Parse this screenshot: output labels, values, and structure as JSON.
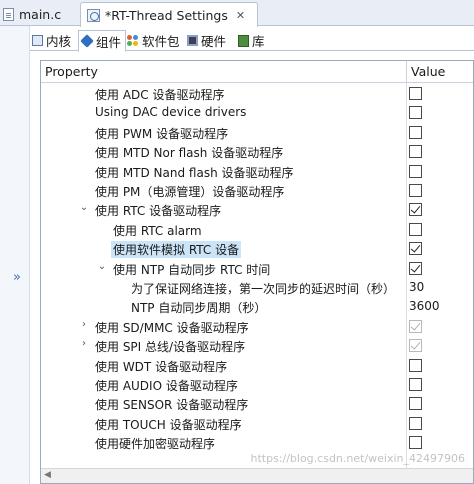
{
  "editor_tabs": [
    {
      "label": "main.c"
    },
    {
      "label": "*RT-Thread Settings",
      "close": "✕"
    }
  ],
  "inner_tabs": [
    {
      "label": "内核"
    },
    {
      "label": "组件"
    },
    {
      "label": "软件包"
    },
    {
      "label": "硬件"
    },
    {
      "label": "库"
    }
  ],
  "side_toggle": "»",
  "table": {
    "header_property": "Property",
    "header_value": "Value",
    "rows": [
      {
        "label": "使用 ADC 设备驱动程序",
        "checked": false
      },
      {
        "label": "Using DAC device drivers",
        "checked": false
      },
      {
        "label": "使用 PWM 设备驱动程序",
        "checked": false
      },
      {
        "label": "使用 MTD Nor flash 设备驱动程序",
        "checked": false
      },
      {
        "label": "使用 MTD Nand flash 设备驱动程序",
        "checked": false
      },
      {
        "label": "使用 PM（电源管理）设备驱动程序",
        "checked": false
      },
      {
        "label": "使用 RTC 设备驱动程序",
        "checked": true,
        "expander": "⌄"
      },
      {
        "label": "使用 RTC alarm",
        "checked": false
      },
      {
        "label": "使用软件模拟 RTC 设备",
        "checked": true
      },
      {
        "label": "使用 NTP 自动同步 RTC 时间",
        "checked": true,
        "expander": "⌄"
      },
      {
        "label": "为了保证网络连接，第一次同步的延迟时间（秒）",
        "value": "30"
      },
      {
        "label": "NTP 自动同步周期（秒）",
        "value": "3600"
      },
      {
        "label": "使用 SD/MMC 设备驱动程序",
        "checked": true,
        "disabled": true,
        "expander": "›"
      },
      {
        "label": "使用 SPI 总线/设备驱动程序",
        "checked": true,
        "disabled": true,
        "expander": "›"
      },
      {
        "label": "使用 WDT 设备驱动程序",
        "checked": false
      },
      {
        "label": "使用 AUDIO 设备驱动程序",
        "checked": false
      },
      {
        "label": "使用 SENSOR 设备驱动程序",
        "checked": false
      },
      {
        "label": "使用 TOUCH 设备驱动程序",
        "checked": false
      },
      {
        "label": "使用硬件加密驱动程序",
        "checked": false
      }
    ]
  },
  "watermark": "https://blog.csdn.net/weixin_42497906"
}
